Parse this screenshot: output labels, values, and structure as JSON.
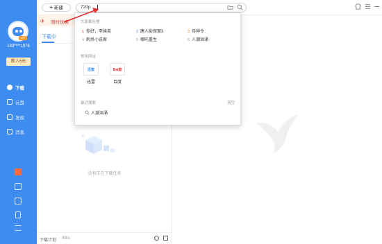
{
  "sidebar": {
    "vip_badge": "VIP",
    "phone": "189****1976",
    "promo_label": "新人6元",
    "nav": [
      {
        "label": "下载",
        "icon": "download-icon"
      },
      {
        "label": "云盘",
        "icon": "cloud-icon"
      },
      {
        "label": "发现",
        "icon": "discover-icon"
      },
      {
        "label": "消息",
        "icon": "message-icon"
      }
    ],
    "tools": [
      "gift-icon",
      "image-icon",
      "crown-icon",
      "tablet-icon",
      "menu-icon"
    ]
  },
  "toolbar": {
    "new_label": "新建",
    "search_value": "720p"
  },
  "download_panel": {
    "promo_text": "限时优惠",
    "tab_label": "下载中",
    "empty_text": "没有正在下载任务",
    "plan_label": "下载计划",
    "plan_value": "0B/s"
  },
  "dropdown": {
    "hot_title": "大家都在搜",
    "hot_items": [
      {
        "rank": "1",
        "text": "你好，李焕英"
      },
      {
        "rank": "2",
        "text": "唐人街探案3"
      },
      {
        "rank": "3",
        "text": "侍神令"
      },
      {
        "rank": "4",
        "text": "刺杀小说家"
      },
      {
        "rank": "5",
        "text": "哪吒重生"
      },
      {
        "rank": "6",
        "text": "人潮汹涌"
      }
    ],
    "sites_title": "常用网址",
    "sites": [
      {
        "logo": "迅雷",
        "label": "迅雷"
      },
      {
        "logo": "Bai度",
        "label": "百度"
      }
    ],
    "recent_title": "最近搜索",
    "clear_label": "清空",
    "recent_items": [
      "人潮汹涌"
    ]
  },
  "colors": {
    "sidebar": "#3f8cf0",
    "accent": "#3f8cf0",
    "arrow": "#e03030"
  }
}
